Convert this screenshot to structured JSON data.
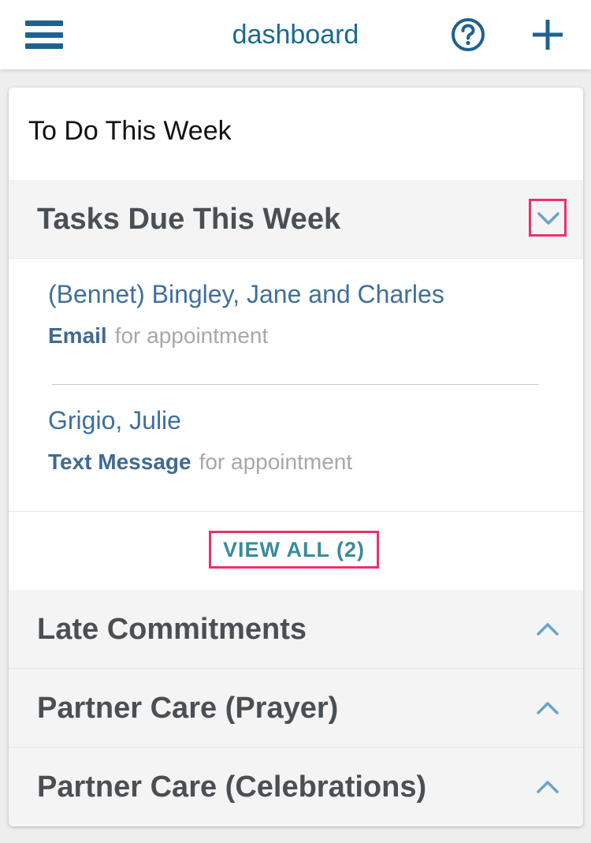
{
  "header": {
    "title": "dashboard",
    "menu_icon": "hamburger-menu-icon",
    "help_icon": "question-circle-icon",
    "add_icon": "plus-icon"
  },
  "card": {
    "title": "To Do This Week",
    "sections": [
      {
        "title": "Tasks Due This Week",
        "expanded": true,
        "tasks": [
          {
            "name": "(Bennet) Bingley, Jane and Charles",
            "type": "Email",
            "description": "for appointment"
          },
          {
            "name": "Grigio, Julie",
            "type": "Text Message",
            "description": "for appointment"
          }
        ],
        "view_all_label": "VIEW ALL (2)"
      },
      {
        "title": "Late Commitments",
        "expanded": false
      },
      {
        "title": "Partner Care (Prayer)",
        "expanded": false
      },
      {
        "title": "Partner Care (Celebrations)",
        "expanded": false
      }
    ]
  },
  "colors": {
    "brand_blue": "#1f628f",
    "link_blue": "#3f6f9c",
    "teal": "#3a8a9f",
    "highlight": "#e8336b",
    "chevron": "#6aa3c9"
  }
}
